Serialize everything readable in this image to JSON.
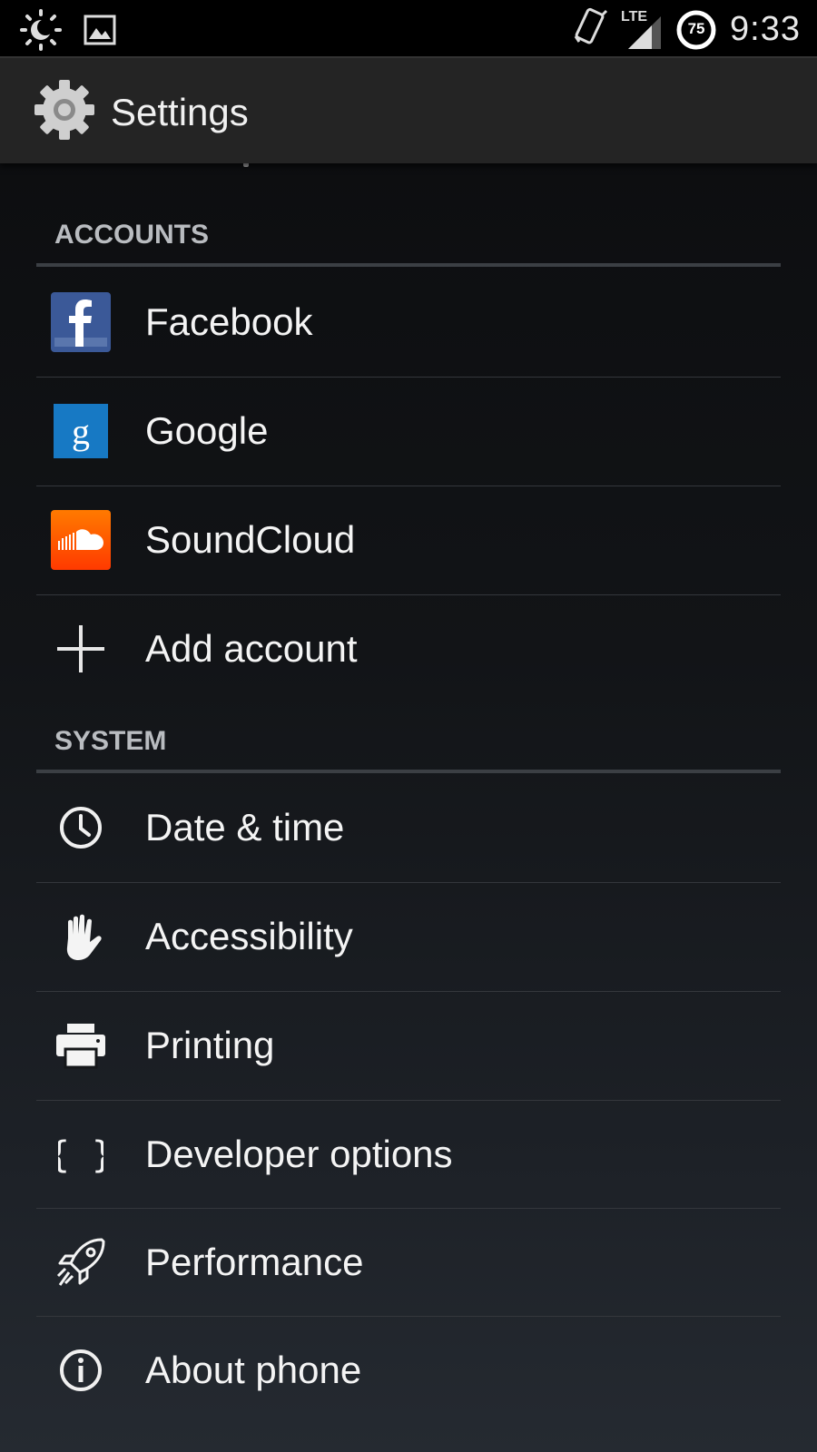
{
  "status_bar": {
    "time": "9:33",
    "battery_level": "75",
    "network_label": "LTE",
    "icons": [
      "brightness-icon",
      "image-icon",
      "vibrate-icon",
      "signal-icon",
      "battery-icon"
    ]
  },
  "action_bar": {
    "title": "Settings",
    "icon": "gear-icon"
  },
  "sections": {
    "accounts": {
      "header": "ACCOUNTS",
      "items": [
        {
          "label": "Facebook",
          "icon": "facebook-icon",
          "color": "#3b5998"
        },
        {
          "label": "Google",
          "icon": "google-icon",
          "color": "#1779c4"
        },
        {
          "label": "SoundCloud",
          "icon": "soundcloud-icon",
          "color": "#ff5500"
        },
        {
          "label": "Add account",
          "icon": "plus-icon"
        }
      ]
    },
    "system": {
      "header": "SYSTEM",
      "items": [
        {
          "label": "Date & time",
          "icon": "clock-icon"
        },
        {
          "label": "Accessibility",
          "icon": "hand-icon"
        },
        {
          "label": "Printing",
          "icon": "printer-icon"
        },
        {
          "label": "Developer options",
          "icon": "braces-icon"
        },
        {
          "label": "Performance",
          "icon": "rocket-icon"
        },
        {
          "label": "About phone",
          "icon": "info-icon"
        }
      ]
    }
  }
}
